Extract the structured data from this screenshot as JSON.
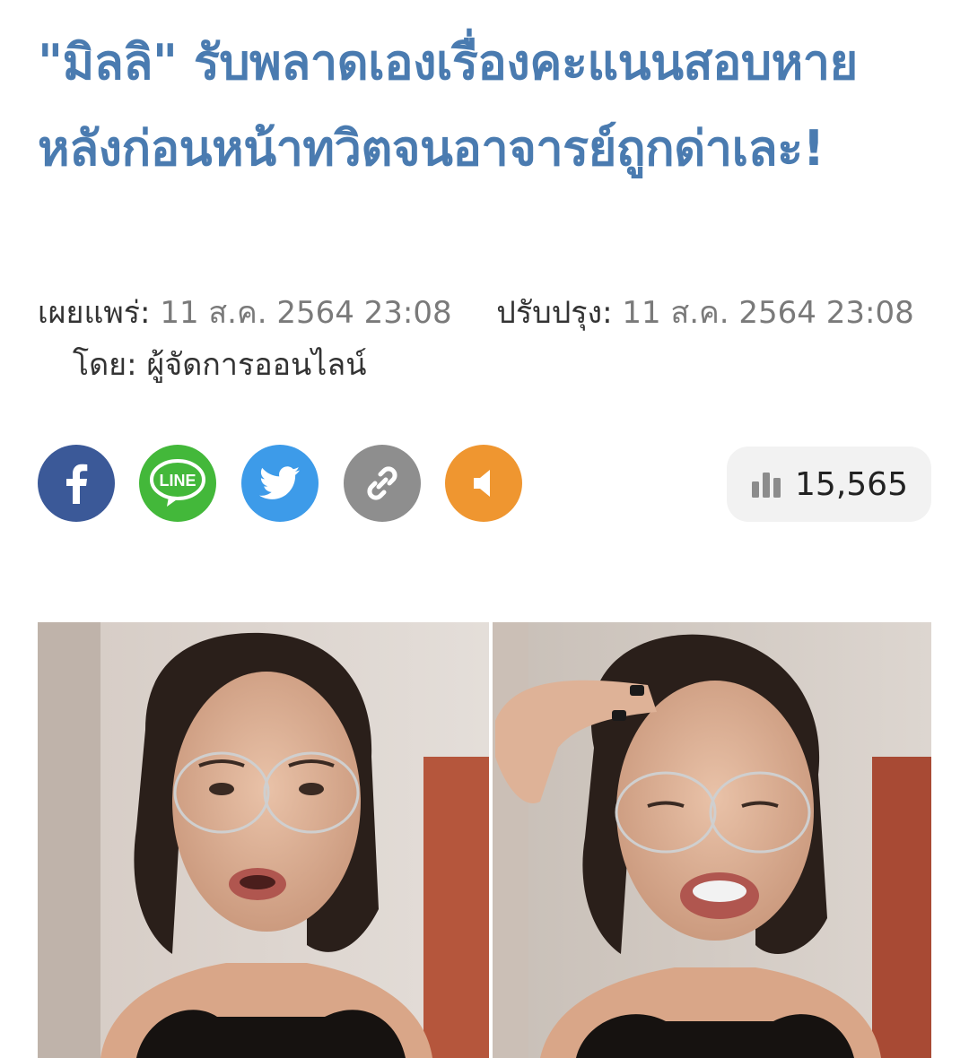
{
  "article": {
    "headline": "\"มิลลิ\" รับพลาดเองเรื่องคะแนนสอบหาย หลังก่อนหน้าทวิตจนอาจารย์ถูกด่าเละ!",
    "published_label": "เผยแพร่:",
    "published_value": "11 ส.ค. 2564 23:08",
    "updated_label": "ปรับปรุง:",
    "updated_value": "11 ส.ค. 2564 23:08",
    "author_label": "โดย:",
    "author_value": "ผู้จัดการออนไลน์"
  },
  "share": {
    "buttons": [
      {
        "icon": "facebook-icon",
        "color": "#3b5998"
      },
      {
        "icon": "line-icon",
        "color": "#43b83a",
        "text": "LINE"
      },
      {
        "icon": "twitter-icon",
        "color": "#3d9be9"
      },
      {
        "icon": "link-icon",
        "color": "#8e8e8e"
      },
      {
        "icon": "speaker-icon",
        "color": "#ef9630"
      }
    ]
  },
  "stats": {
    "views_icon": "bar-chart-icon",
    "views": "15,565"
  },
  "colors": {
    "headline": "#4a7bb0",
    "meta_text": "#666666"
  }
}
